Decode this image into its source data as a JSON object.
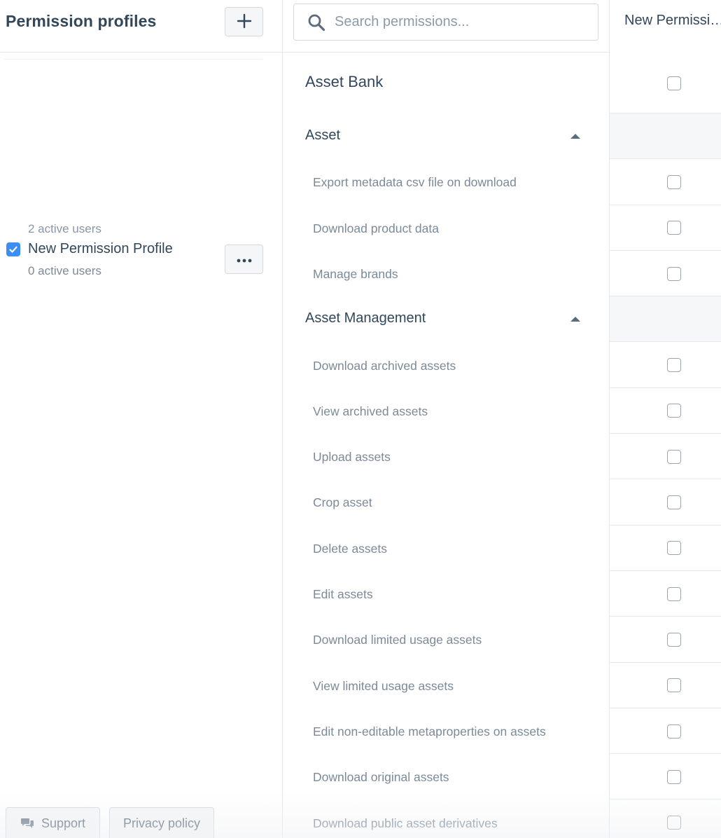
{
  "sidebar": {
    "title": "Permission profiles",
    "add_button_icon": "plus-icon",
    "cut_off_text": "2 active users",
    "profile": {
      "name": "New Permission Profile",
      "subtitle": "0 active users",
      "selected": true,
      "more_icon": "ellipsis-icon"
    },
    "footer": {
      "support_label": "Support",
      "support_icon": "chat-icon",
      "privacy_label": "Privacy policy"
    }
  },
  "search": {
    "placeholder": "Search permissions...",
    "icon": "search-icon"
  },
  "permissions": {
    "group_title": "Asset Bank",
    "sections": [
      {
        "title": "Asset",
        "expanded": true,
        "items": [
          "Export metadata csv file on download",
          "Download product data",
          "Manage brands"
        ]
      },
      {
        "title": "Asset Management",
        "expanded": true,
        "items": [
          "Download archived assets",
          "View archived assets",
          "Upload assets",
          "Crop asset",
          "Delete assets",
          "Edit assets",
          "Download limited usage assets",
          "View limited usage assets",
          "Edit non-editable metaproperties on assets",
          "Download original assets",
          "Download public asset derivatives"
        ]
      }
    ]
  },
  "profile_column": {
    "header": "New Permissi…"
  },
  "colors": {
    "accent": "#3b8ef3",
    "text_primary": "#33475b",
    "text_muted": "#7c8a98",
    "border": "#e5e8eb",
    "section_row_bg": "#f5f7f9"
  }
}
